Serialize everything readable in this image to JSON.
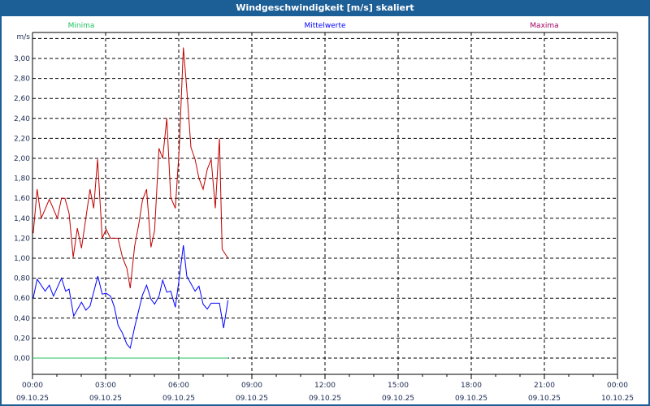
{
  "window": {
    "title": "Windgeschwindigkeit [m/s] skaliert"
  },
  "chart_data": {
    "type": "line",
    "title": "Windgeschwindigkeit [m/s] skaliert",
    "ylabel": "m/s",
    "xlabel": "",
    "ylim": [
      0,
      3.2
    ],
    "xlim_hours": [
      0,
      24
    ],
    "y_ticks": [
      "0,00",
      "0,20",
      "0,40",
      "0,60",
      "0,80",
      "1,00",
      "1,20",
      "1,40",
      "1,60",
      "1,80",
      "2,00",
      "2,20",
      "2,40",
      "2,60",
      "2,80",
      "3,00"
    ],
    "x_ticks": [
      {
        "time": "00:00",
        "date": "09.10.25"
      },
      {
        "time": "03:00",
        "date": "09.10.25"
      },
      {
        "time": "06:00",
        "date": "09.10.25"
      },
      {
        "time": "09:00",
        "date": "09.10.25"
      },
      {
        "time": "12:00",
        "date": "09.10.25"
      },
      {
        "time": "15:00",
        "date": "09.10.25"
      },
      {
        "time": "18:00",
        "date": "09.10.25"
      },
      {
        "time": "21:00",
        "date": "09.10.25"
      },
      {
        "time": "00:00",
        "date": "10.10.25"
      }
    ],
    "grid": true,
    "legend_position": "top",
    "series": [
      {
        "name": "Minima",
        "color": "#20c060",
        "x": [
          0,
          8.02
        ],
        "y": [
          0,
          0
        ]
      },
      {
        "name": "Mittelwerte",
        "color": "#0000ff",
        "x": [
          0.03,
          0.19,
          0.52,
          0.69,
          0.86,
          1.19,
          1.36,
          1.5,
          1.69,
          2.01,
          2.19,
          2.36,
          2.68,
          2.86,
          3.02,
          3.2,
          3.36,
          3.51,
          3.69,
          3.87,
          4.01,
          4.19,
          4.51,
          4.68,
          4.86,
          5.01,
          5.19,
          5.34,
          5.51,
          5.67,
          5.86,
          6.02,
          6.19,
          6.33,
          6.67,
          6.83,
          7.0,
          7.17,
          7.33,
          7.67,
          7.84,
          8.02
        ],
        "y": [
          0.6,
          0.79,
          0.67,
          0.73,
          0.62,
          0.8,
          0.67,
          0.69,
          0.42,
          0.56,
          0.48,
          0.52,
          0.82,
          0.64,
          0.65,
          0.62,
          0.51,
          0.33,
          0.25,
          0.14,
          0.1,
          0.31,
          0.63,
          0.73,
          0.59,
          0.54,
          0.62,
          0.78,
          0.66,
          0.67,
          0.51,
          0.8,
          1.13,
          0.82,
          0.67,
          0.72,
          0.54,
          0.49,
          0.55,
          0.55,
          0.3,
          0.58
        ]
      },
      {
        "name": "Maxima",
        "color": "#c00000",
        "x": [
          0.03,
          0.19,
          0.36,
          0.69,
          1.02,
          1.19,
          1.33,
          1.5,
          1.67,
          1.84,
          2.01,
          2.36,
          2.51,
          2.67,
          2.76,
          2.86,
          3.02,
          3.2,
          3.51,
          3.69,
          3.87,
          4.01,
          4.19,
          4.36,
          4.51,
          4.68,
          4.86,
          5.01,
          5.19,
          5.34,
          5.51,
          5.67,
          5.86,
          6.02,
          6.19,
          6.33,
          6.5,
          6.67,
          6.83,
          7.0,
          7.17,
          7.33,
          7.5,
          7.67,
          7.78,
          8.02
        ],
        "y": [
          1.25,
          1.69,
          1.4,
          1.59,
          1.4,
          1.6,
          1.6,
          1.45,
          1.01,
          1.3,
          1.1,
          1.69,
          1.5,
          1.99,
          1.61,
          1.2,
          1.29,
          1.2,
          1.2,
          1.01,
          0.9,
          0.7,
          1.12,
          1.34,
          1.58,
          1.69,
          1.11,
          1.28,
          2.1,
          2.0,
          2.4,
          1.61,
          1.5,
          2.1,
          3.11,
          2.69,
          2.11,
          1.99,
          1.8,
          1.69,
          1.89,
          1.99,
          1.5,
          2.2,
          1.09,
          1.0
        ]
      }
    ],
    "legend_colors": {
      "Minima": "#20c060",
      "Mittelwerte": "#0000ff",
      "Maxima": "#a00060"
    }
  }
}
